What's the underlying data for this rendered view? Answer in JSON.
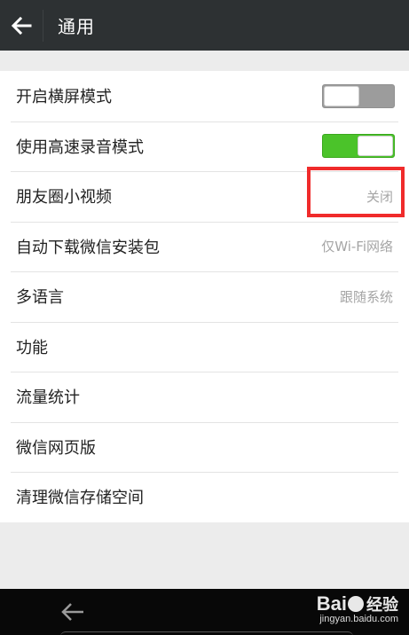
{
  "header": {
    "title": "通用"
  },
  "settings": [
    {
      "label": "开启横屏模式",
      "type": "toggle",
      "state": "off"
    },
    {
      "label": "使用高速录音模式",
      "type": "toggle",
      "state": "on"
    },
    {
      "label": "朋友圈小视频",
      "type": "value",
      "value": "关闭"
    },
    {
      "label": "自动下载微信安装包",
      "type": "value",
      "value": "仅Wi-Fi网络"
    },
    {
      "label": "多语言",
      "type": "value",
      "value": "跟随系统"
    },
    {
      "label": "功能",
      "type": "link"
    },
    {
      "label": "流量统计",
      "type": "link"
    },
    {
      "label": "微信网页版",
      "type": "link"
    },
    {
      "label": "清理微信存储空间",
      "type": "link"
    }
  ],
  "colors": {
    "toggle_on": "#4bc32a",
    "toggle_off": "#9c9c9c",
    "highlight_box": "#f02b2b",
    "topbar": "#2d3133"
  },
  "watermark": {
    "brand_left": "Bai",
    "brand_right": "经验",
    "url": "jingyan.baidu.com"
  }
}
